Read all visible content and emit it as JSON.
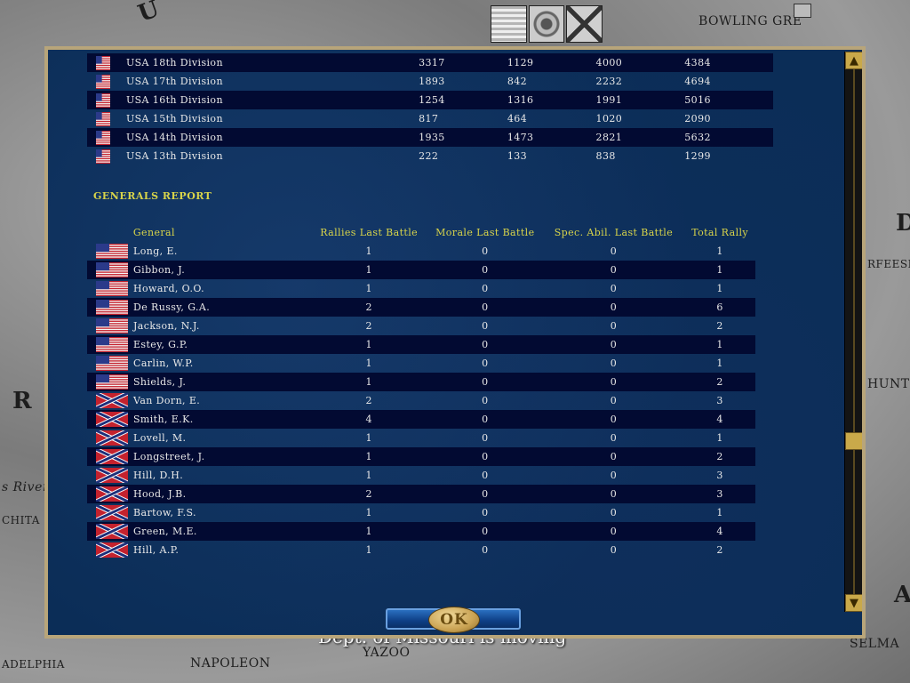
{
  "map": {
    "labels": {
      "bowling_green": "BOWLING GRE",
      "rfeesb": "RFEESB",
      "hunts": "HUNTS",
      "s_river": "s River",
      "chita": "CHITA",
      "adelphia": "ADELPHIA",
      "napoleon": "NAPOLEON",
      "yazoo": "YAZOO",
      "selma": "SELMA",
      "big_r": "R",
      "big_d": "D",
      "big_a": "A",
      "big_u": "U"
    },
    "banner": "Dept. of Missouri is moving"
  },
  "divisions": [
    {
      "name": "USA 18th Division",
      "v1": "3317",
      "v2": "1129",
      "v3": "4000",
      "v4": "4384",
      "side": "usa"
    },
    {
      "name": "USA 17th Division",
      "v1": "1893",
      "v2": "842",
      "v3": "2232",
      "v4": "4694",
      "side": "usa"
    },
    {
      "name": "USA 16th Division",
      "v1": "1254",
      "v2": "1316",
      "v3": "1991",
      "v4": "5016",
      "side": "usa"
    },
    {
      "name": "USA 15th Division",
      "v1": "817",
      "v2": "464",
      "v3": "1020",
      "v4": "2090",
      "side": "usa"
    },
    {
      "name": "USA 14th Division",
      "v1": "1935",
      "v2": "1473",
      "v3": "2821",
      "v4": "5632",
      "side": "usa"
    },
    {
      "name": "USA 13th Division",
      "v1": "222",
      "v2": "133",
      "v3": "838",
      "v4": "1299",
      "side": "usa"
    }
  ],
  "generals_report": {
    "title": "GENERALS REPORT",
    "headers": {
      "general": "General",
      "rallies": "Rallies Last Battle",
      "morale": "Morale Last Battle",
      "spec": "Spec. Abil. Last Battle",
      "total": "Total Rally"
    },
    "rows": [
      {
        "name": "Long, E.",
        "rallies": "1",
        "morale": "0",
        "spec": "0",
        "total": "1",
        "side": "usa"
      },
      {
        "name": "Gibbon, J.",
        "rallies": "1",
        "morale": "0",
        "spec": "0",
        "total": "1",
        "side": "usa"
      },
      {
        "name": "Howard, O.O.",
        "rallies": "1",
        "morale": "0",
        "spec": "0",
        "total": "1",
        "side": "usa"
      },
      {
        "name": "De Russy, G.A.",
        "rallies": "2",
        "morale": "0",
        "spec": "0",
        "total": "6",
        "side": "usa"
      },
      {
        "name": "Jackson, N.J.",
        "rallies": "2",
        "morale": "0",
        "spec": "0",
        "total": "2",
        "side": "usa"
      },
      {
        "name": "Estey, G.P.",
        "rallies": "1",
        "morale": "0",
        "spec": "0",
        "total": "1",
        "side": "usa"
      },
      {
        "name": "Carlin, W.P.",
        "rallies": "1",
        "morale": "0",
        "spec": "0",
        "total": "1",
        "side": "usa"
      },
      {
        "name": "Shields, J.",
        "rallies": "1",
        "morale": "0",
        "spec": "0",
        "total": "2",
        "side": "usa"
      },
      {
        "name": "Van Dorn, E.",
        "rallies": "2",
        "morale": "0",
        "spec": "0",
        "total": "3",
        "side": "csa"
      },
      {
        "name": "Smith, E.K.",
        "rallies": "4",
        "morale": "0",
        "spec": "0",
        "total": "4",
        "side": "csa"
      },
      {
        "name": "Lovell, M.",
        "rallies": "1",
        "morale": "0",
        "spec": "0",
        "total": "1",
        "side": "csa"
      },
      {
        "name": "Longstreet, J.",
        "rallies": "1",
        "morale": "0",
        "spec": "0",
        "total": "2",
        "side": "csa"
      },
      {
        "name": "Hill, D.H.",
        "rallies": "1",
        "morale": "0",
        "spec": "0",
        "total": "3",
        "side": "csa"
      },
      {
        "name": "Hood, J.B.",
        "rallies": "2",
        "morale": "0",
        "spec": "0",
        "total": "3",
        "side": "csa"
      },
      {
        "name": "Bartow, F.S.",
        "rallies": "1",
        "morale": "0",
        "spec": "0",
        "total": "1",
        "side": "csa"
      },
      {
        "name": "Green, M.E.",
        "rallies": "1",
        "morale": "0",
        "spec": "0",
        "total": "4",
        "side": "csa"
      },
      {
        "name": "Hill, A.P.",
        "rallies": "1",
        "morale": "0",
        "spec": "0",
        "total": "2",
        "side": "csa"
      }
    ]
  },
  "ok_button": {
    "label": "OK"
  },
  "scrollbar": {
    "up_icon": "▲",
    "down_icon": "▼"
  },
  "colors": {
    "dialog_bg": "#0b2d57",
    "header_text": "#d8d44a",
    "row_text": "#e8e8e8",
    "frame": "#b8a57a"
  }
}
